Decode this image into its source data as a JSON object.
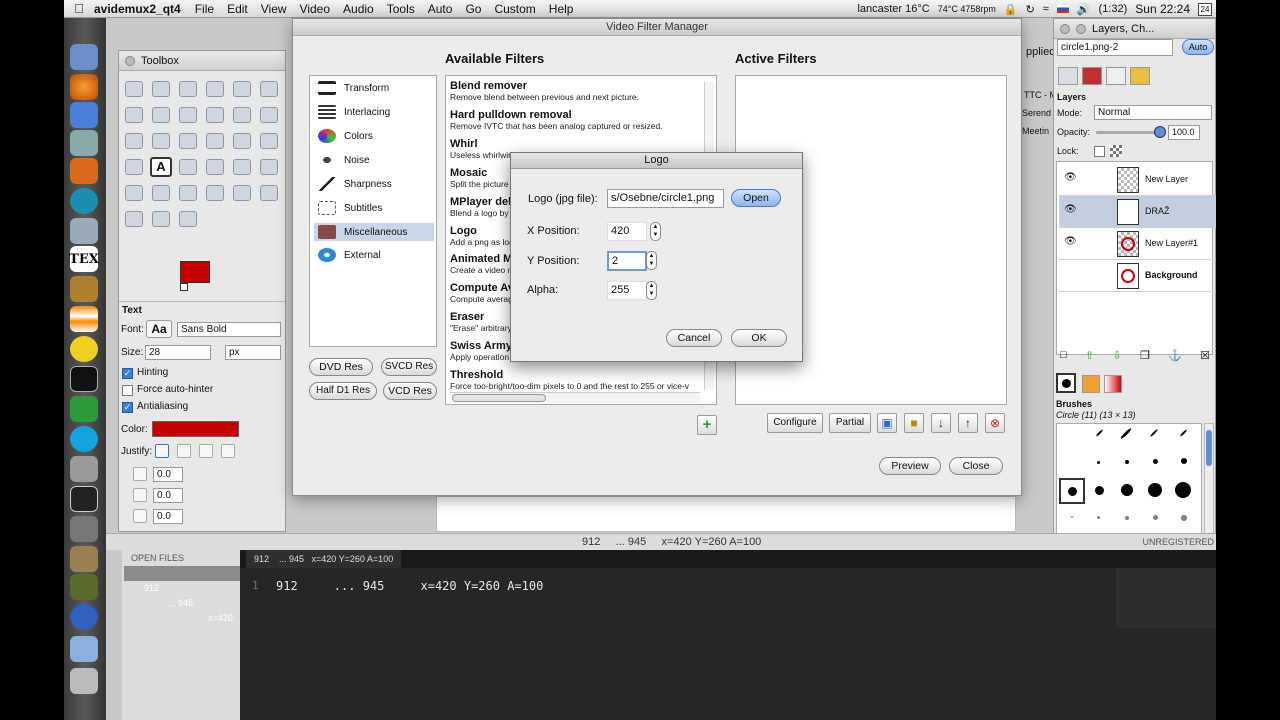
{
  "menubar": {
    "app_name": "avidemux2_qt4",
    "items": [
      "File",
      "Edit",
      "View",
      "Video",
      "Audio",
      "Tools",
      "Auto",
      "Go",
      "Custom",
      "Help"
    ],
    "status": {
      "location": "lancaster 16°C",
      "cpu": "74°C 4758rpm",
      "battery": "(1:32)",
      "clock": "Sun 22:24",
      "date": "24"
    }
  },
  "toolbox": {
    "title": "Toolbox",
    "text_section": "Text",
    "font_label": "Font:",
    "font_preview": "Aa",
    "font_value": "Sans Bold",
    "size_label": "Size:",
    "size_value": "28",
    "size_unit": "px",
    "hinting": "Hinting",
    "force_autohinter": "Force auto-hinter",
    "antialiasing": "Antialiasing",
    "color_label": "Color:",
    "justify_label": "Justify:",
    "spin1": "0.0",
    "spin2": "0.0",
    "spin3": "0.0",
    "fg_color": "#c40000"
  },
  "vfm": {
    "title": "Video Filter Manager",
    "available_heading": "Available Filters",
    "active_heading": "Active Filters",
    "categories": [
      "Transform",
      "Interlacing",
      "Colors",
      "Noise",
      "Sharpness",
      "Subtitles",
      "Miscellaneous",
      "External"
    ],
    "selected_category": "Miscellaneous",
    "filters": [
      {
        "name": "Blend remover",
        "desc": "Remove blend between previous and next picture."
      },
      {
        "name": "Hard pulldown removal",
        "desc": "Remove IVTC that has been analog captured or resized."
      },
      {
        "name": "Whirl",
        "desc": "Useless whirlwind"
      },
      {
        "name": "Mosaic",
        "desc": "Split the picture"
      },
      {
        "name": "MPlayer del",
        "desc": "Blend a logo by"
      },
      {
        "name": "Logo",
        "desc": "Add a png as log"
      },
      {
        "name": "Animated M",
        "desc": "Create a video m"
      },
      {
        "name": "Compute Av",
        "desc": "Compute averag"
      },
      {
        "name": "Eraser",
        "desc": "\"Erase\" arbitrary"
      },
      {
        "name": "Swiss Army",
        "desc": "Apply operation"
      },
      {
        "name": "Threshold",
        "desc": "Force too-bright/too-dim pixels to 0 and the rest to 255 or vice-v"
      }
    ],
    "buttons": {
      "dvd": "DVD Res",
      "svcd": "SVCD Res",
      "halfd1": "Half D1 Res",
      "vcd": "VCD Res",
      "configure": "Configure",
      "partial": "Partial",
      "preview": "Preview",
      "close": "Close"
    }
  },
  "logo_dialog": {
    "title": "Logo",
    "file_label": "Logo (jpg file):",
    "file_value": "s/Osebne/circle1.png",
    "open": "Open",
    "x_label": "X Position:",
    "x_value": "420",
    "y_label": "Y Position:",
    "y_value": "2",
    "alpha_label": "Alpha:",
    "alpha_value": "255",
    "cancel": "Cancel",
    "ok": "OK"
  },
  "layers": {
    "window_title": "Layers, Ch...",
    "image_select": "circle1.png-2",
    "auto": "Auto",
    "section": "Layers",
    "mode_label": "Mode:",
    "mode_value": "Normal",
    "opacity_label": "Opacity:",
    "opacity_value": "100.0",
    "lock_label": "Lock:",
    "items": [
      "New Layer",
      "DRAŽ",
      "New Layer#1",
      "Background"
    ],
    "brushes_label": "Brushes",
    "brush_name": "Circle (11) (13 × 13)"
  },
  "background_text": {
    "applied": "pplied",
    "itc": "TTC - M",
    "seren": "Serend",
    "meetin": "Meetin"
  },
  "statusbar": {
    "text": "912     ... 945     x=420 Y=260 A=100",
    "unregistered": "UNREGISTERED"
  },
  "editor": {
    "open_files_label": "OPEN FILES",
    "open_file_a": "912",
    "open_file_b": "... 945",
    "open_file_c": "x=420",
    "tab_label": "912    ... 945   x=420 Y=260 A=100",
    "line_number": "1",
    "line_text": "912     ... 945     x=420 Y=260 A=100"
  }
}
